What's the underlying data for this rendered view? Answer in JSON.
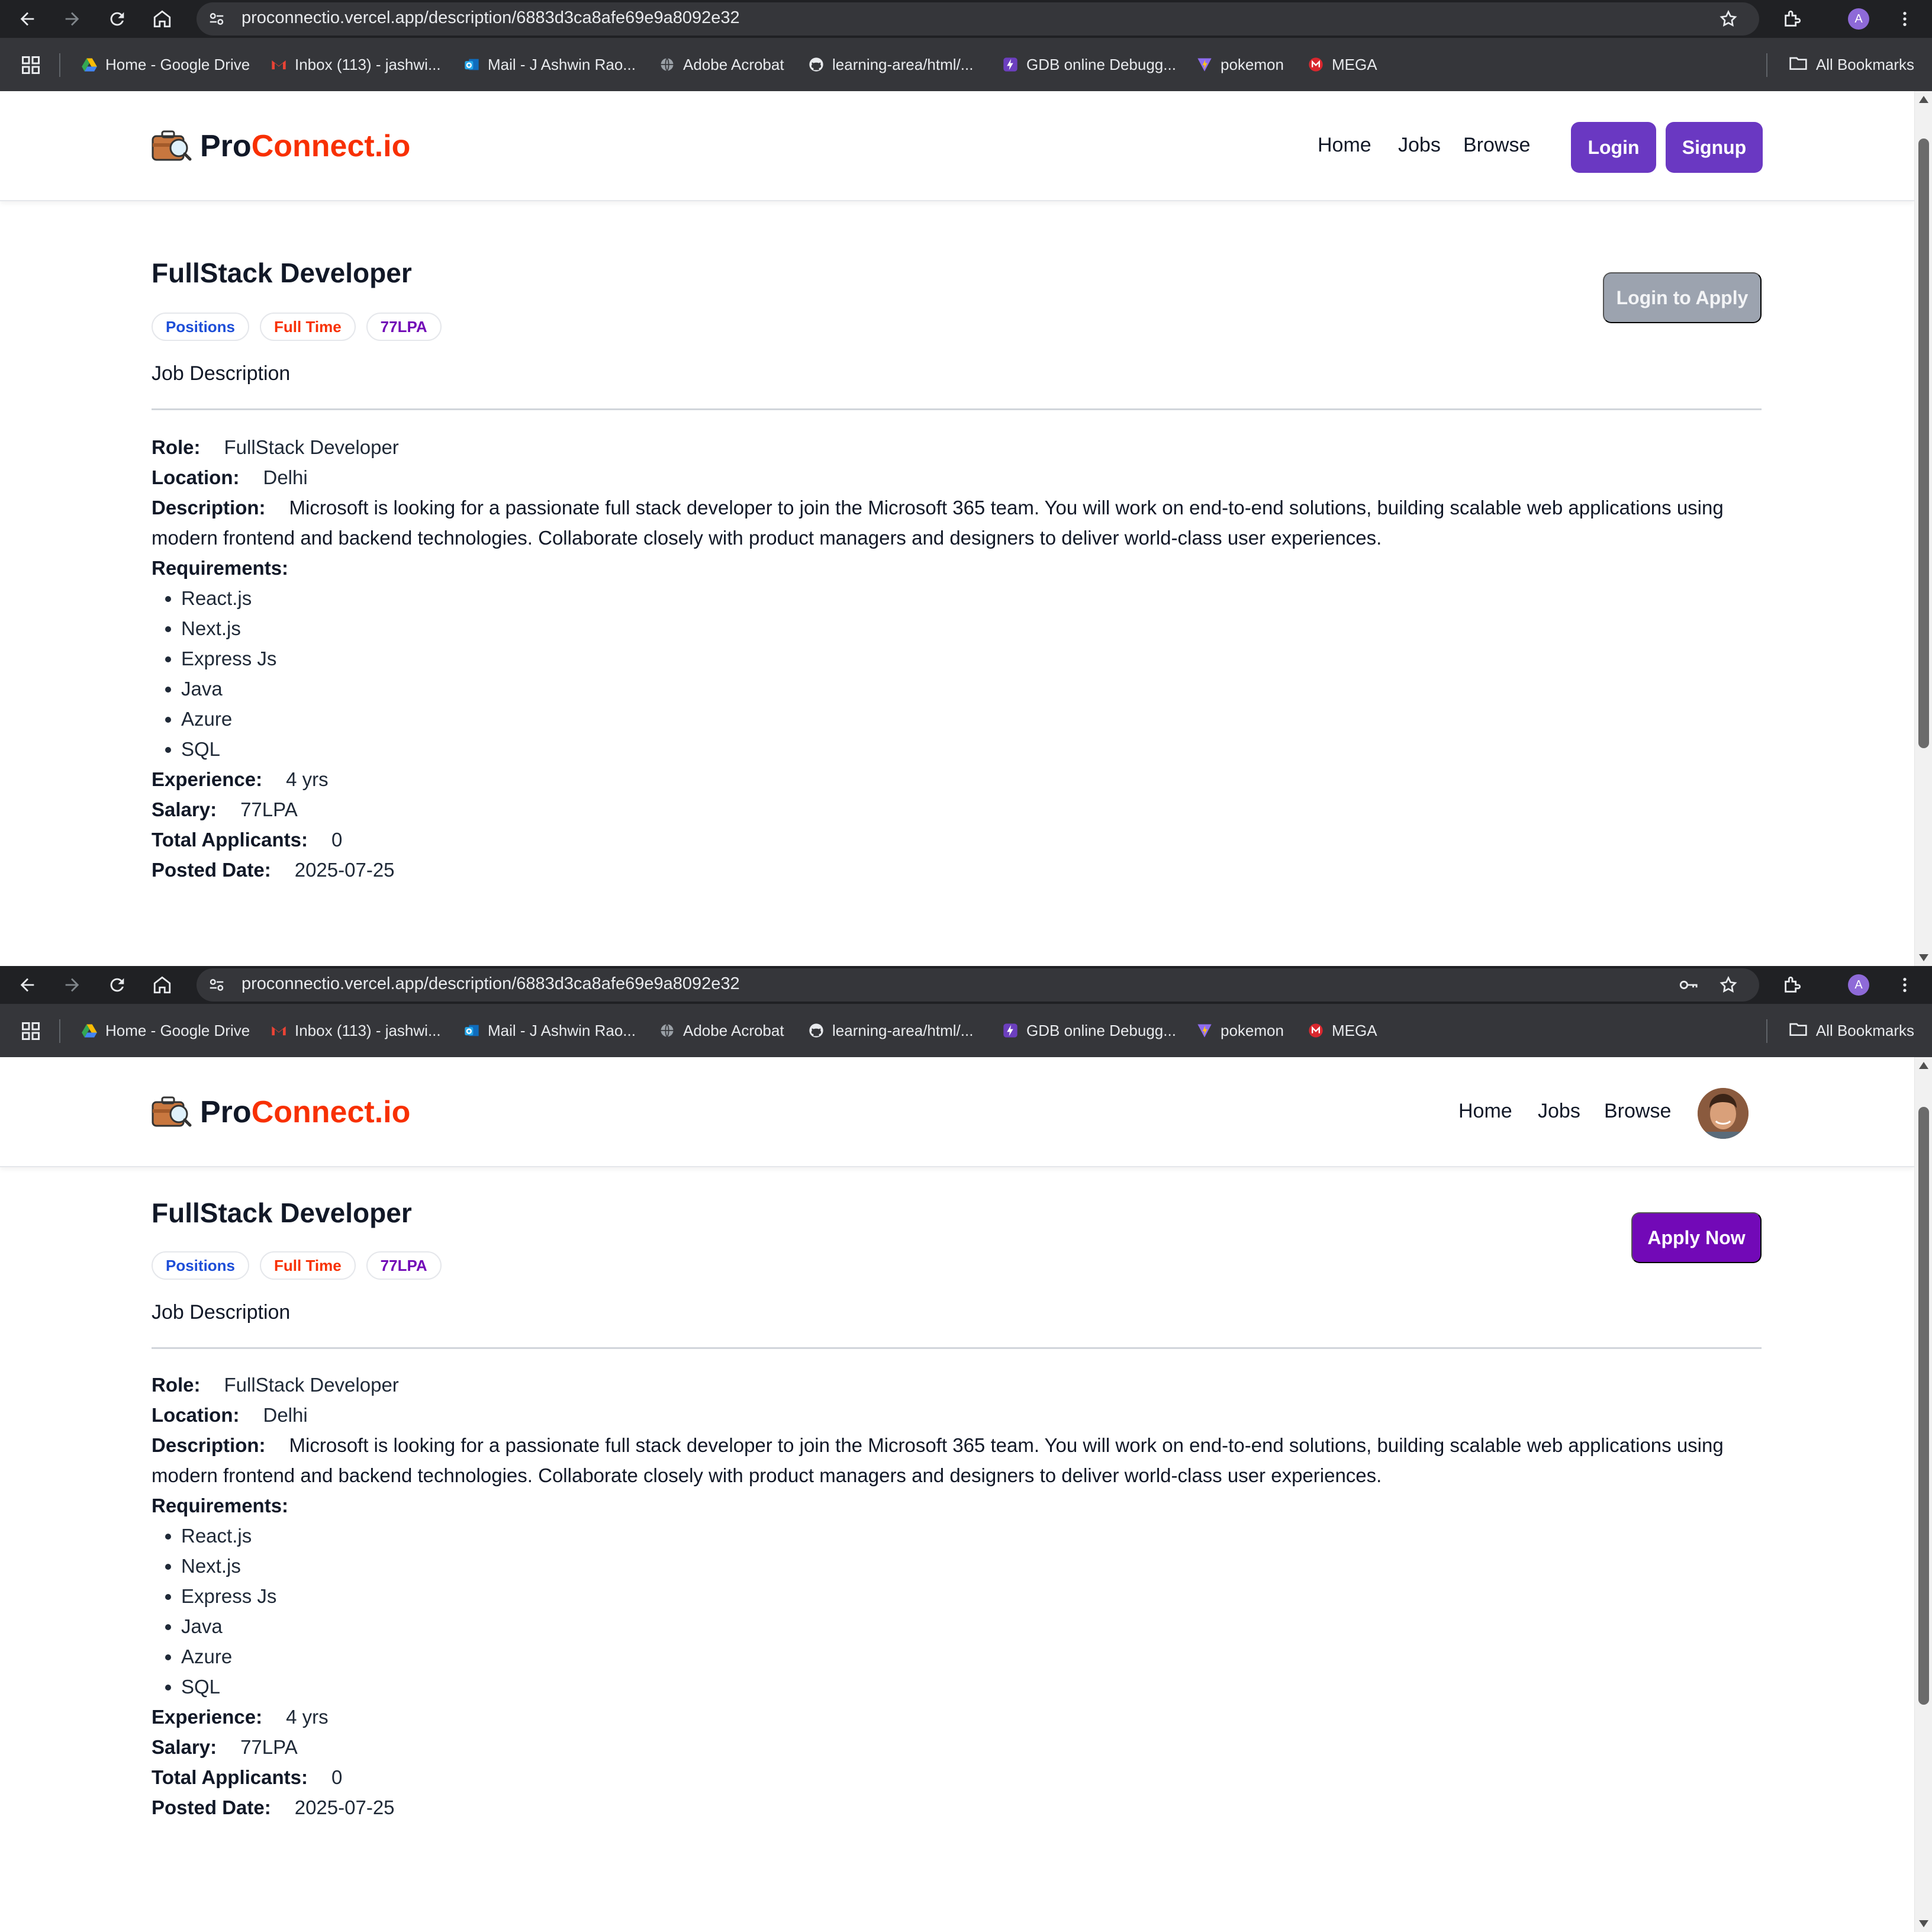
{
  "browser": {
    "url": "proconnectio.vercel.app/description/6883d3ca8afe69e9a8092e32",
    "profile_initial": "A",
    "bookmarks": [
      {
        "label": "Home - Google Drive",
        "icon": "google-drive-icon"
      },
      {
        "label": "Inbox (113) - jashwi...",
        "icon": "gmail-icon"
      },
      {
        "label": "Mail - J Ashwin Rao...",
        "icon": "outlook-icon"
      },
      {
        "label": "Adobe Acrobat",
        "icon": "globe-icon"
      },
      {
        "label": "learning-area/html/...",
        "icon": "github-icon"
      },
      {
        "label": "GDB online Debugg...",
        "icon": "bolt-icon"
      },
      {
        "label": "pokemon",
        "icon": "vite-icon"
      },
      {
        "label": "MEGA",
        "icon": "mega-icon"
      }
    ],
    "all_bookmarks": "All Bookmarks"
  },
  "site": {
    "logo_prefix": "Pro",
    "logo_accent": "Connect.io",
    "nav": {
      "home": "Home",
      "jobs": "Jobs",
      "browse": "Browse"
    },
    "login": "Login",
    "signup": "Signup"
  },
  "job": {
    "title": "FullStack Developer",
    "badges": {
      "positions": "Positions",
      "type": "Full Time",
      "salary": "77LPA"
    },
    "login_to_apply": "Login to Apply",
    "apply_now": "Apply Now",
    "section_heading": "Job Description",
    "labels": {
      "role": "Role:",
      "location": "Location:",
      "description": "Description:",
      "requirements": "Requirements:",
      "experience": "Experience:",
      "salary": "Salary:",
      "applicants": "Total Applicants:",
      "posted": "Posted Date:"
    },
    "role": "FullStack Developer",
    "location": "Delhi",
    "description": "Microsoft is looking for a passionate full stack developer to join the Microsoft 365 team. You will work on end-to-end solutions, building scalable web applications using modern frontend and backend technologies. Collaborate closely with product managers and designers to deliver world-class user experiences.",
    "requirements": [
      "React.js",
      "Next.js",
      "Express Js",
      "Java",
      "Azure",
      "SQL"
    ],
    "experience": "4 yrs",
    "salary": "77LPA",
    "applicants": "0",
    "posted_date": "2025-07-25"
  },
  "colors": {
    "brand_purple": "#6a38c2",
    "apply_purple": "#7209b7",
    "logo_red": "#f83002",
    "disabled_gray": "#9ca3af"
  }
}
